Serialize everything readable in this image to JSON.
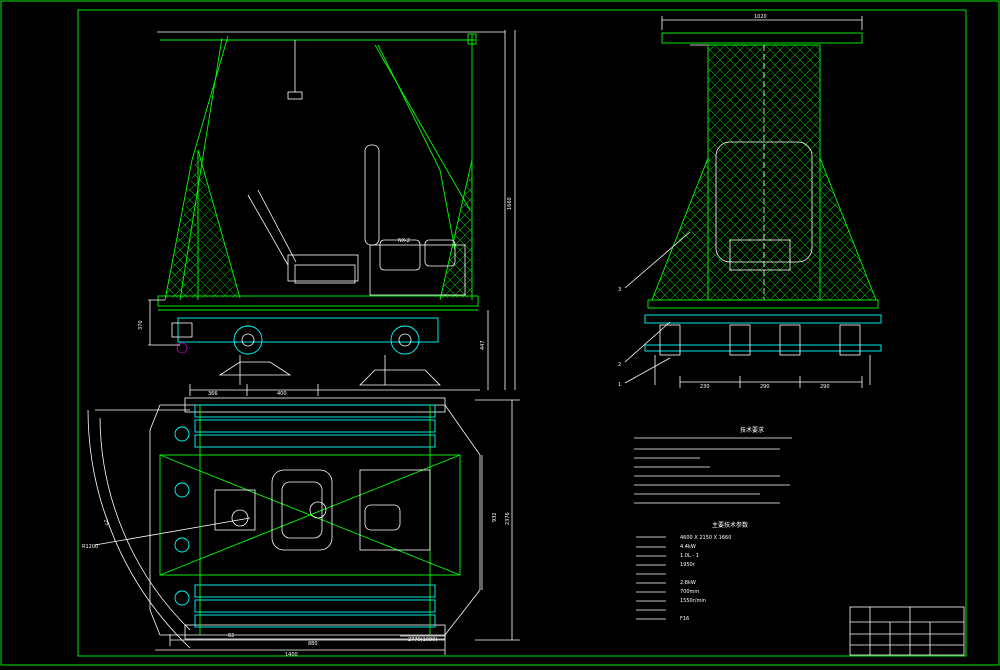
{
  "drawing": {
    "side_view": {
      "dimensions": [
        "1660",
        "370",
        "447",
        "366",
        "400"
      ]
    },
    "front_view": {
      "dimensions": [
        "1020",
        "230",
        "290",
        "290"
      ],
      "callouts": [
        "3",
        "2",
        "1"
      ]
    },
    "plan_view": {
      "dimensions": [
        "R1200",
        "25",
        "932",
        "2376",
        "62",
        "880",
        "1400",
        "2770(1090)"
      ]
    },
    "technical_requirements": {
      "title": "技术要求",
      "items": [
        "",
        "",
        "",
        "",
        "",
        "",
        "",
        "",
        ""
      ]
    },
    "parameters_table": {
      "title": "主要技术参数",
      "rows": [
        {
          "value": "4600 X 2150 X 1660"
        },
        {
          "value": "4.4kW"
        },
        {
          "value": "1.0L - 1"
        },
        {
          "value": "1950r"
        },
        {
          "value": ""
        },
        {
          "value": "2.8kW"
        },
        {
          "value": "700mm"
        },
        {
          "value": "1550r/min"
        },
        {
          "value": ""
        },
        {
          "value": "F16"
        }
      ]
    },
    "title_block": {
      "label_1": "",
      "label_2": "",
      "sign": ""
    }
  }
}
